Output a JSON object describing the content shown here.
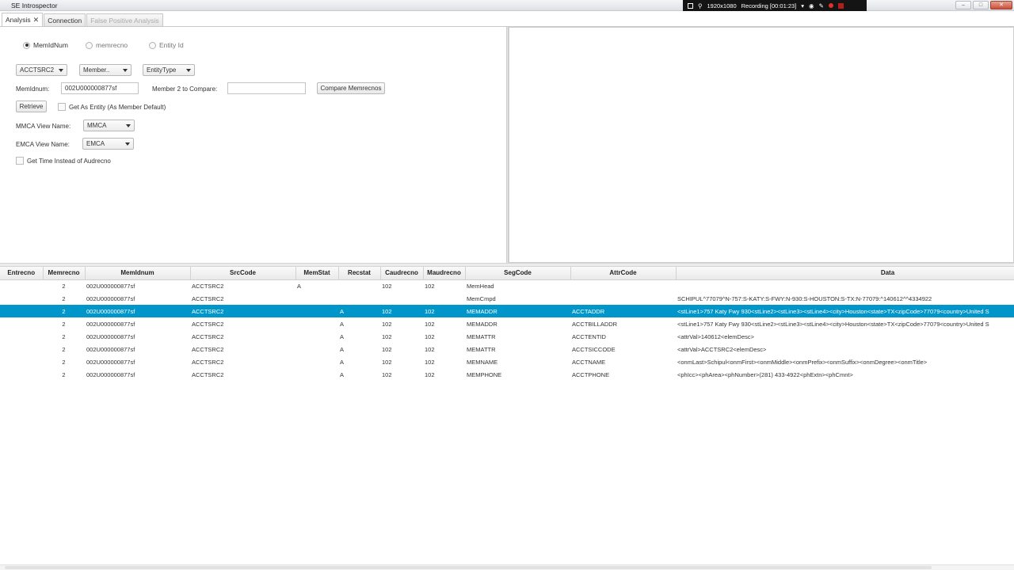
{
  "window": {
    "title": "SE Introspector"
  },
  "recording": {
    "resolution": "1920x1080",
    "status": "Recording [00:01:23]"
  },
  "tabs": [
    {
      "label": "Analysis",
      "state": "active",
      "close": "✕"
    },
    {
      "label": "Connection",
      "state": "normal"
    },
    {
      "label": "False Positive Analysis",
      "state": "disabled"
    }
  ],
  "form": {
    "radios": [
      {
        "label": "MemIdNum",
        "selected": true
      },
      {
        "label": "memrecno",
        "selected": false
      },
      {
        "label": "Entity Id",
        "selected": false
      }
    ],
    "combos": {
      "src": "ACCTSRC2",
      "member": "Member..",
      "entity_type": "EntityType"
    },
    "memidnum_label": "MemIdnum:",
    "memidnum_value": "002U000000877sf",
    "member2_label": "Member 2 to Compare:",
    "member2_value": "",
    "compare_button": "Compare Memrecnos",
    "retrieve_button": "Retrieve",
    "get_as_entity": "Get As Entity (As Member Default)",
    "mmca_label": "MMCA View Name:",
    "mmca_value": "MMCA",
    "emca_label": "EMCA View Name:",
    "emca_value": "EMCA",
    "get_time": "Get Time Instead of Audrecno"
  },
  "table": {
    "columns": [
      "Entrecno",
      "Memrecno",
      "MemIdnum",
      "SrcCode",
      "MemStat",
      "Recstat",
      "Caudrecno",
      "Maudrecno",
      "SegCode",
      "AttrCode",
      "Data"
    ],
    "rows": [
      {
        "entrecno": "",
        "memrecno": "2",
        "memidnum": "002U000000877sf",
        "srccode": "ACCTSRC2",
        "memstat": "A",
        "recstat": "",
        "caudrecno": "102",
        "maudrecno": "102",
        "segcode": "MemHead",
        "attrcode": "",
        "data": ""
      },
      {
        "entrecno": "",
        "memrecno": "2",
        "memidnum": "002U000000877sf",
        "srccode": "ACCTSRC2",
        "memstat": "",
        "recstat": "",
        "caudrecno": "",
        "maudrecno": "",
        "segcode": "MemCmpd",
        "attrcode": "",
        "data": "SCHIPUL^77079^N-757:S-KATY:S-FWY:N-930:S-HOUSTON:S-TX:N-77079:^140612^^4334922"
      },
      {
        "entrecno": "",
        "memrecno": "2",
        "memidnum": "002U000000877sf",
        "srccode": "ACCTSRC2",
        "memstat": "",
        "recstat": "A",
        "caudrecno": "102",
        "maudrecno": "102",
        "segcode": "MEMADDR",
        "attrcode": "ACCTADDR",
        "data": "<stLine1>757 Katy Fwy 930<stLine2><stLine3><stLine4><city>Houston<state>TX<zipCode>77079<country>United S",
        "selected": true
      },
      {
        "entrecno": "",
        "memrecno": "2",
        "memidnum": "002U000000877sf",
        "srccode": "ACCTSRC2",
        "memstat": "",
        "recstat": "A",
        "caudrecno": "102",
        "maudrecno": "102",
        "segcode": "MEMADDR",
        "attrcode": "ACCTBILLADDR",
        "data": "<stLine1>757 Katy Fwy 930<stLine2><stLine3><stLine4><city>Houston<state>TX<zipCode>77079<country>United S"
      },
      {
        "entrecno": "",
        "memrecno": "2",
        "memidnum": "002U000000877sf",
        "srccode": "ACCTSRC2",
        "memstat": "",
        "recstat": "A",
        "caudrecno": "102",
        "maudrecno": "102",
        "segcode": "MEMATTR",
        "attrcode": "ACCTENTID",
        "data": "<attrVal>140612<elemDesc>"
      },
      {
        "entrecno": "",
        "memrecno": "2",
        "memidnum": "002U000000877sf",
        "srccode": "ACCTSRC2",
        "memstat": "",
        "recstat": "A",
        "caudrecno": "102",
        "maudrecno": "102",
        "segcode": "MEMATTR",
        "attrcode": "ACCTSICCODE",
        "data": "<attrVal>ACCTSRC2<elemDesc>"
      },
      {
        "entrecno": "",
        "memrecno": "2",
        "memidnum": "002U000000877sf",
        "srccode": "ACCTSRC2",
        "memstat": "",
        "recstat": "A",
        "caudrecno": "102",
        "maudrecno": "102",
        "segcode": "MEMNAME",
        "attrcode": "ACCTNAME",
        "data": "<onmLast>Schipul<onmFirst><onmMiddle><onmPrefix><onmSuffix><onmDegree><onmTitle>"
      },
      {
        "entrecno": "",
        "memrecno": "2",
        "memidnum": "002U000000877sf",
        "srccode": "ACCTSRC2",
        "memstat": "",
        "recstat": "A",
        "caudrecno": "102",
        "maudrecno": "102",
        "segcode": "MEMPHONE",
        "attrcode": "ACCTPHONE",
        "data": "<phIcc><phArea><phNumber>(281) 433-4922<phExtn><phCmnt>"
      }
    ]
  },
  "colors": {
    "selection": "#0096c9",
    "record_dot": "#e23030"
  },
  "icons": [
    "app-icon",
    "screen-icon",
    "zoom-icon",
    "camera-icon",
    "pen-icon",
    "minimize-icon",
    "maximize-icon",
    "close-icon",
    "chevron-down-icon"
  ]
}
